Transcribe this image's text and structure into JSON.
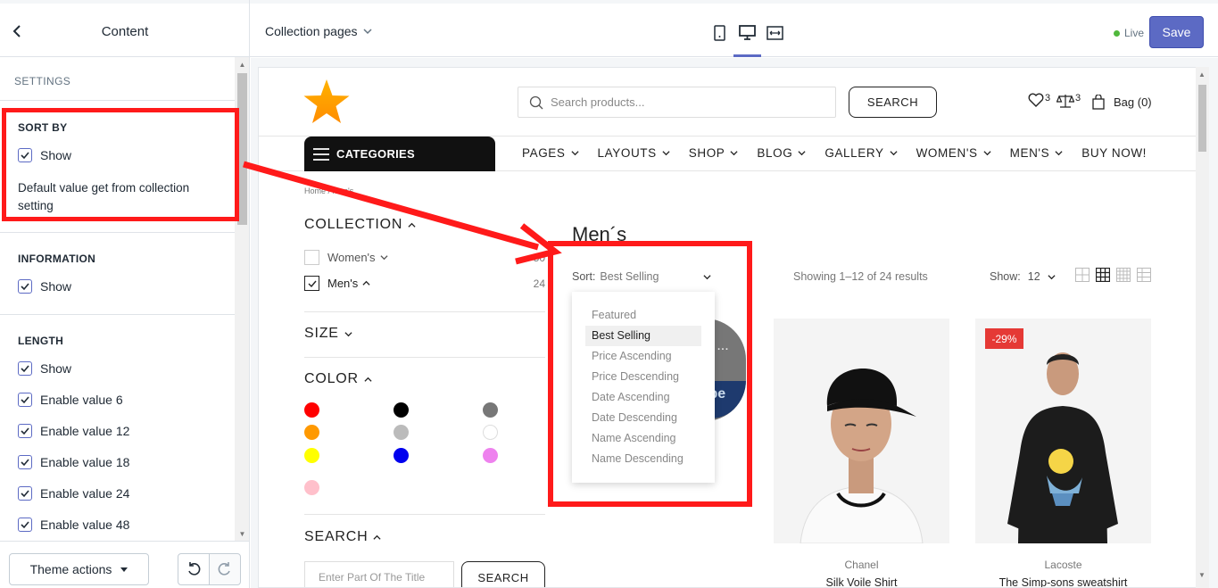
{
  "editor": {
    "sidebar_title": "Content",
    "template_selector": "Collection pages",
    "live_label": "Live",
    "save_label": "Save",
    "theme_actions_label": "Theme actions",
    "devices": [
      "mobile-icon",
      "desktop-icon",
      "fullwidth-icon"
    ]
  },
  "sidebar": {
    "settings_label": "SETTINGS",
    "sort_by": {
      "title": "SORT BY",
      "show_label": "Show",
      "note": "Default value get from collection setting"
    },
    "information": {
      "title": "INFORMATION",
      "show_label": "Show"
    },
    "length": {
      "title": "LENGTH",
      "options": [
        "Show",
        "Enable value 6",
        "Enable value 12",
        "Enable value 18",
        "Enable value 24",
        "Enable value 48"
      ]
    }
  },
  "store": {
    "search_placeholder": "Search products...",
    "search_button": "SEARCH",
    "wishlist_count": "3",
    "compare_count": "3",
    "bag_label": "Bag (0)",
    "categories_label": "CATEGORIES",
    "nav": [
      "PAGES",
      "LAYOUTS",
      "SHOP",
      "BLOG",
      "GALLERY",
      "WOMEN'S",
      "MEN'S",
      "BUY NOW!"
    ],
    "breadcrumb": "Home / Men's",
    "filters": {
      "collection_title": "COLLECTION",
      "collections": [
        {
          "label": "Women's",
          "count": "50",
          "checked": false
        },
        {
          "label": "Men's",
          "count": "24",
          "checked": true
        }
      ],
      "size_title": "SIZE",
      "color_title": "COLOR",
      "colors": [
        "#ff0000",
        "#000000",
        "#777777",
        "#ff9900",
        "#bbbbbb",
        "#ffffff",
        "#ffff00",
        "#0000ee",
        "#ee82ee",
        "#ffc0cb"
      ],
      "search_title": "SEARCH",
      "search_placeholder": "Enter Part Of The Title",
      "search_button": "SEARCH"
    },
    "collection_title": "Men´s",
    "sort_label": "Sort:",
    "sort_value": "Best Selling",
    "sort_options": [
      "Featured",
      "Best Selling",
      "Price Ascending",
      "Price Descending",
      "Date Ascending",
      "Date Descending",
      "Name Ascending",
      "Name Descending"
    ],
    "results_text": "Showing 1–12 of 24 results",
    "show_label": "Show:",
    "show_value": "12",
    "products": [
      {
        "brand": "Chanel",
        "name": "Silk Voile Shirt",
        "badge": ""
      },
      {
        "brand": "Lacoste",
        "name": "The Simp-sons sweatshirt",
        "badge": "-29%"
      }
    ]
  },
  "colors": {
    "accent": "#5c6ac4",
    "annotation": "#ff1a1a",
    "live_dot": "#50b83c"
  }
}
